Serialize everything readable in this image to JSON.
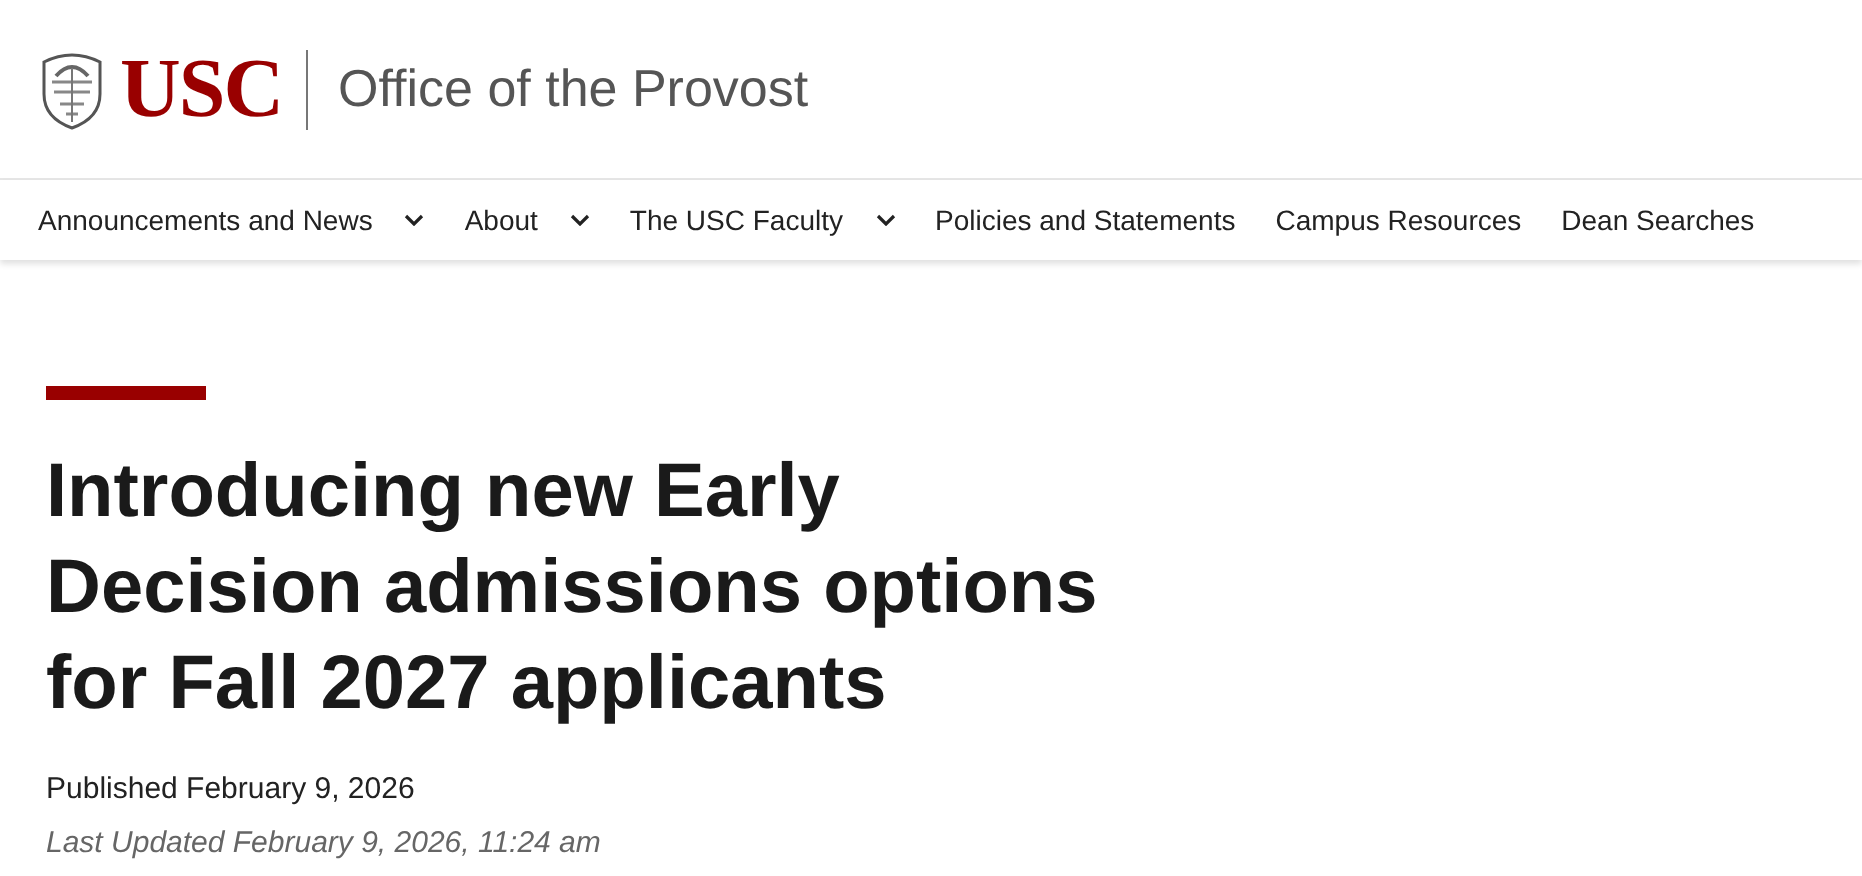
{
  "header": {
    "logo": "USC",
    "site_title": "Office of the Provost"
  },
  "nav": [
    {
      "label": "Announcements and News",
      "has_menu": true
    },
    {
      "label": "About",
      "has_menu": true
    },
    {
      "label": "The USC Faculty",
      "has_menu": true
    },
    {
      "label": "Policies and Statements",
      "has_menu": false
    },
    {
      "label": "Campus Resources",
      "has_menu": false
    },
    {
      "label": "Dean Searches",
      "has_menu": false
    }
  ],
  "article": {
    "title": "Introducing new Early Decision admissions options for Fall 2027 applicants",
    "published": "Published February 9, 2026",
    "last_updated": "Last Updated February 9, 2026, 11:24 am"
  }
}
